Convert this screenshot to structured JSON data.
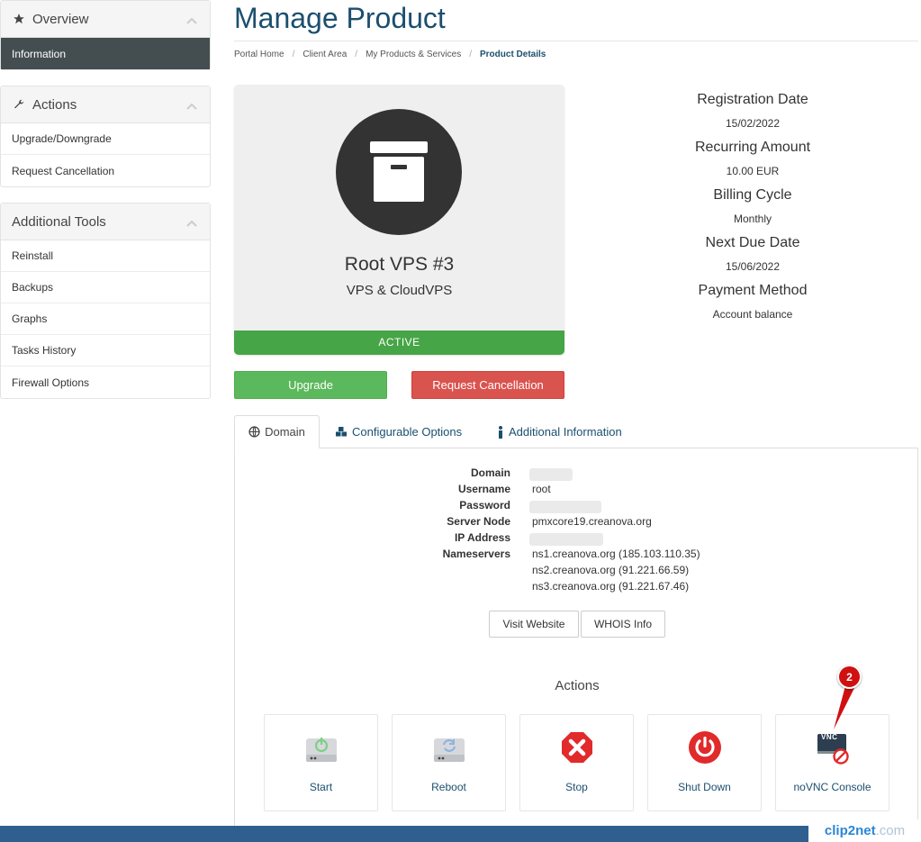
{
  "sidebar": {
    "overview": {
      "title": "Overview",
      "items": [
        "Information"
      ]
    },
    "actions": {
      "title": "Actions",
      "items": [
        "Upgrade/Downgrade",
        "Request Cancellation"
      ]
    },
    "tools": {
      "title": "Additional Tools",
      "items": [
        "Reinstall",
        "Backups",
        "Graphs",
        "Tasks History",
        "Firewall Options"
      ]
    }
  },
  "page": {
    "title": "Manage Product"
  },
  "breadcrumb": [
    "Portal Home",
    "Client Area",
    "My Products & Services",
    "Product Details"
  ],
  "product": {
    "name": "Root VPS #3",
    "group": "VPS & CloudVPS",
    "status": "ACTIVE"
  },
  "info": [
    {
      "label": "Registration Date",
      "value": "15/02/2022"
    },
    {
      "label": "Recurring Amount",
      "value": "10.00 EUR"
    },
    {
      "label": "Billing Cycle",
      "value": "Monthly"
    },
    {
      "label": "Next Due Date",
      "value": "15/06/2022"
    },
    {
      "label": "Payment Method",
      "value": "Account balance"
    }
  ],
  "buttons": {
    "upgrade": "Upgrade",
    "cancel": "Request Cancellation"
  },
  "tabs": [
    "Domain",
    "Configurable Options",
    "Additional Information"
  ],
  "details": {
    "domain_label": "Domain",
    "domain_value": "",
    "username_label": "Username",
    "username_value": "root",
    "password_label": "Password",
    "password_value": "",
    "node_label": "Server Node",
    "node_value": "pmxcore19.creanova.org",
    "ip_label": "IP Address",
    "ip_value": "",
    "ns_label": "Nameservers",
    "ns": [
      "ns1.creanova.org (185.103.110.35)",
      "ns2.creanova.org (91.221.66.59)",
      "ns3.creanova.org (91.221.67.46)"
    ]
  },
  "link_buttons": {
    "visit": "Visit Website",
    "whois": "WHOIS Info"
  },
  "actions": {
    "title": "Actions",
    "items": [
      "Start",
      "Reboot",
      "Stop",
      "Shut Down",
      "noVNC Console"
    ],
    "vnc_icon_text": "VNC"
  },
  "annotation": {
    "number": "2"
  },
  "watermark": {
    "brand": "clip2net",
    "suffix": ".com"
  },
  "colors": {
    "primary": "#1b4f6e",
    "active": "#46a546",
    "upgrade": "#5cb85c",
    "cancel": "#d9534f",
    "sidebar_active": "#444e50"
  }
}
